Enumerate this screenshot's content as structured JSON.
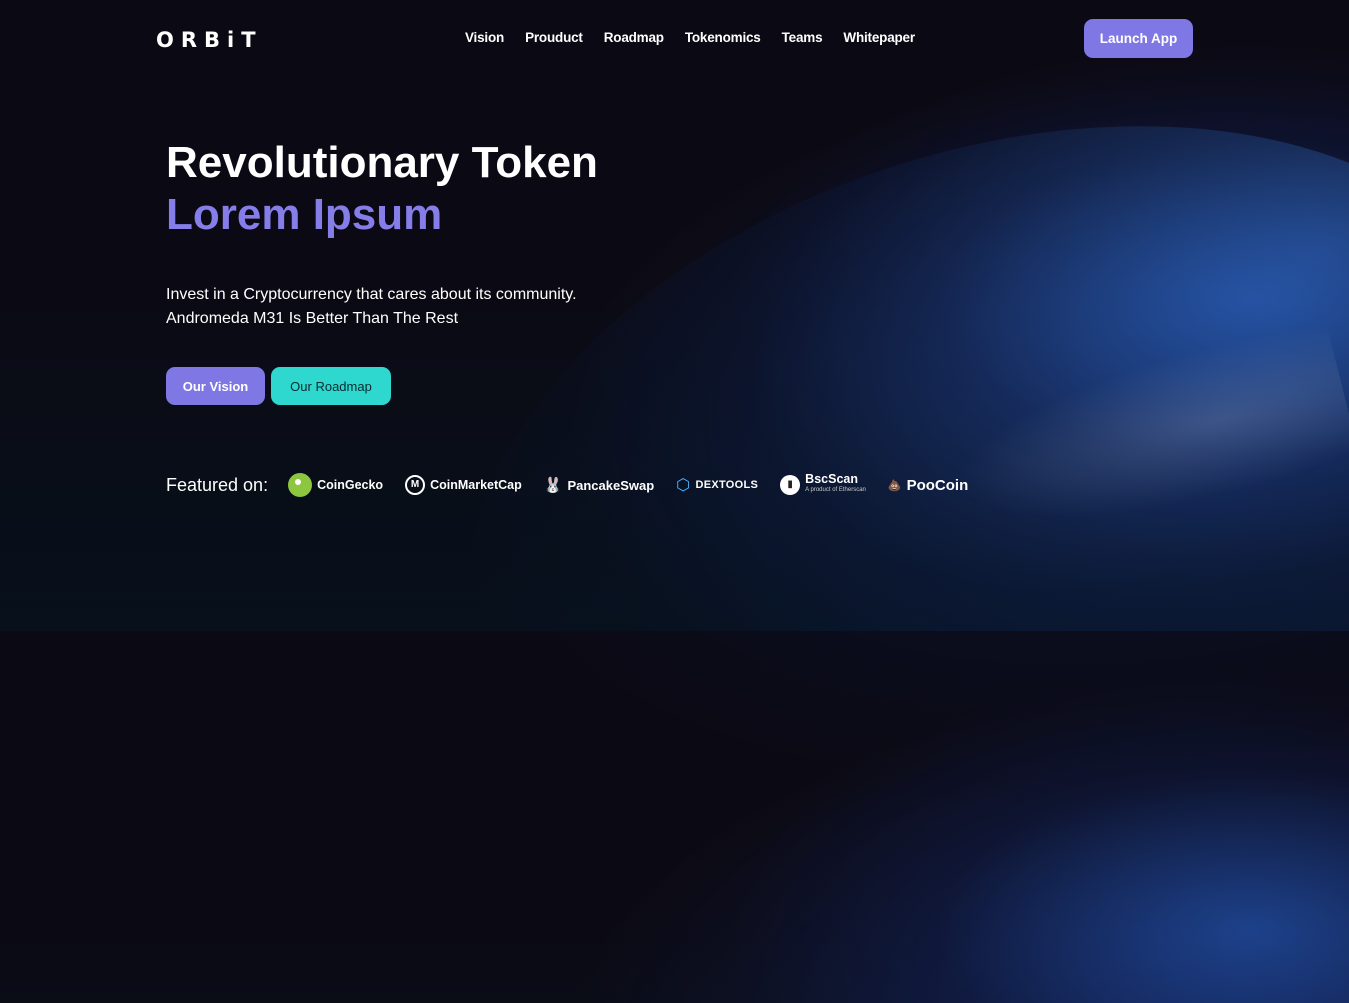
{
  "header": {
    "logo": "ORBiT",
    "nav": [
      "Vision",
      "Prouduct",
      "Roadmap",
      "Tokenomics",
      "Teams",
      "Whitepaper"
    ],
    "launch_label": "Launch App"
  },
  "hero": {
    "title_line1": "Revolutionary Token",
    "title_line2": "Lorem Ipsum",
    "subtitle_line1": "Invest in a Cryptocurrency that cares about its community.",
    "subtitle_line2": "Andromeda M31 Is Better Than The Rest",
    "primary_button": "Our Vision",
    "secondary_button": "Our Roadmap"
  },
  "featured": {
    "label": "Featured on:",
    "partners": [
      {
        "name": "CoinGecko",
        "icon": "coingecko-icon"
      },
      {
        "name": "CoinMarketCap",
        "icon": "coinmarketcap-icon"
      },
      {
        "name": "PancakeSwap",
        "icon": "pancakeswap-icon"
      },
      {
        "name": "DEXTOOLS",
        "icon": "dextools-icon"
      },
      {
        "name": "BscScan",
        "sub": "A product of Etherscan",
        "icon": "bscscan-icon"
      },
      {
        "name": "PooCoin",
        "icon": "poocoin-icon"
      }
    ]
  },
  "colors": {
    "accent": "#7f77e4",
    "accent_text": "#857de8",
    "teal": "#2fd8cf",
    "background": "#0b0913"
  }
}
